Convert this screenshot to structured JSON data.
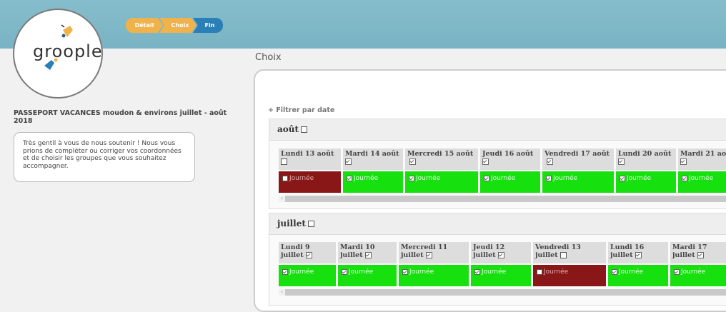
{
  "app": {
    "logo_text": "groople",
    "steps": [
      "Détail",
      "Choix",
      "Fin"
    ]
  },
  "page": {
    "section_title": "Choix",
    "project_title": "PASSEPORT VACANCES moudon & environs juillet - août 2018",
    "message": "Très gentil à vous de nous soutenir ! Nous vous prions de compléter ou corriger vos coordonnées et de choisir les groupes que vous souhaitez accompagner.",
    "filter_link": "+ Filtrer par date"
  },
  "months": [
    {
      "name": "août",
      "checked": false,
      "days": [
        {
          "label": "Lundi 13 août",
          "checked": false,
          "slot": "Journée",
          "slot_checked": false
        },
        {
          "label": "Mardi 14 août",
          "checked": true,
          "slot": "Journée",
          "slot_checked": true
        },
        {
          "label": "Mercredi 15 août",
          "checked": true,
          "slot": "Journée",
          "slot_checked": true
        },
        {
          "label": "Jeudi 16 août",
          "checked": true,
          "slot": "Journée",
          "slot_checked": true
        },
        {
          "label": "Vendredi 17 août",
          "checked": true,
          "slot": "Journée",
          "slot_checked": true
        },
        {
          "label": "Lundi 20 août",
          "checked": true,
          "slot": "Journée",
          "slot_checked": true
        },
        {
          "label": "Mardi 21 août",
          "checked": true,
          "slot": "Journée",
          "slot_checked": true
        }
      ]
    },
    {
      "name": "juillet",
      "checked": false,
      "days": [
        {
          "label": "Lundi 9 juillet",
          "checked": true,
          "slot": "Journée",
          "slot_checked": true
        },
        {
          "label": "Mardi 10 juillet",
          "checked": true,
          "slot": "Journée",
          "slot_checked": true
        },
        {
          "label": "Mercredi 11 juillet",
          "checked": true,
          "slot": "Journée",
          "slot_checked": true
        },
        {
          "label": "Jeudi 12 juillet",
          "checked": true,
          "slot": "Journée",
          "slot_checked": true
        },
        {
          "label": "Vendredi 13 juillet",
          "checked": false,
          "slot": "Journée",
          "slot_checked": false
        },
        {
          "label": "Lundi 16 juillet",
          "checked": true,
          "slot": "Journée",
          "slot_checked": true
        },
        {
          "label": "Mardi 17 juillet",
          "checked": true,
          "slot": "Journée",
          "slot_checked": true
        }
      ]
    }
  ],
  "colors": {
    "header": "#7fb7c7",
    "step_active": "#2a7fb6",
    "step_done": "#f0b24a",
    "slot_on": "#16e00e",
    "slot_off": "#8a1717"
  }
}
